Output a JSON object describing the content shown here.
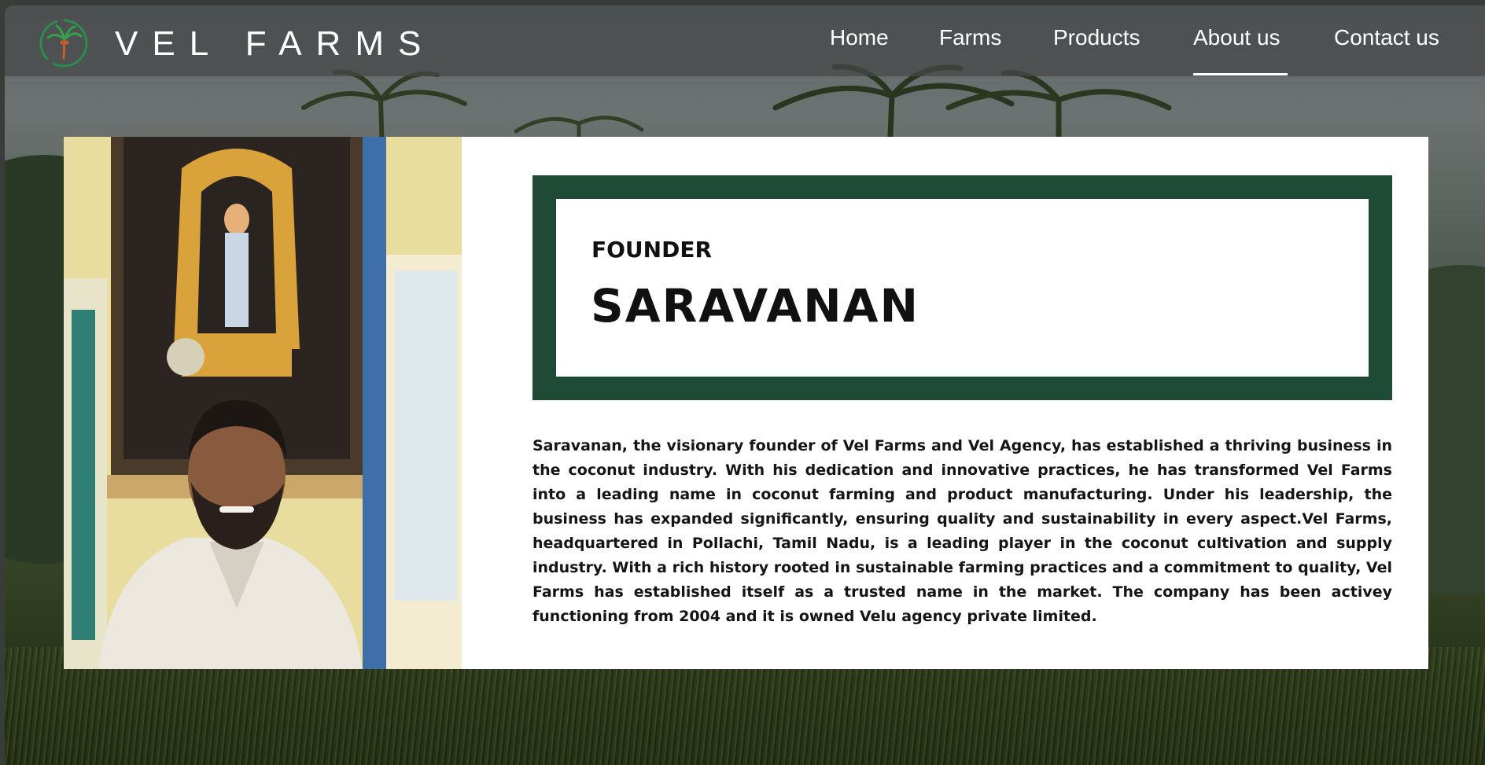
{
  "brand": {
    "name": "VEL FARMS"
  },
  "nav": {
    "items": [
      {
        "label": "Home"
      },
      {
        "label": "Farms"
      },
      {
        "label": "Products"
      },
      {
        "label": "About us",
        "active": true
      },
      {
        "label": "Contact us"
      }
    ]
  },
  "founder": {
    "role": "FOUNDER",
    "name": "SARAVANAN",
    "bio": "Saravanan, the visionary founder of Vel Farms and Vel Agency, has established a thriving business in the coconut industry. With his dedication and innovative practices, he has transformed Vel Farms into a leading name in coconut farming and product manufacturing. Under his leadership, the business has expanded significantly, ensuring quality and sustainability in every aspect.Vel Farms, headquartered in Pollachi, Tamil Nadu, is a leading player in the coconut cultivation and supply industry. With a rich history rooted in sustainable farming practices and a commitment to quality, Vel Farms has established itself as a trusted name in the market. The company has been activey functioning from 2004 and it is owned Velu agency private limited."
  },
  "colors": {
    "accent": "#1f4a35",
    "nav_bg": "#464848",
    "text": "#151515"
  },
  "icons": {
    "logo": "coconut-palm-logo-icon"
  }
}
